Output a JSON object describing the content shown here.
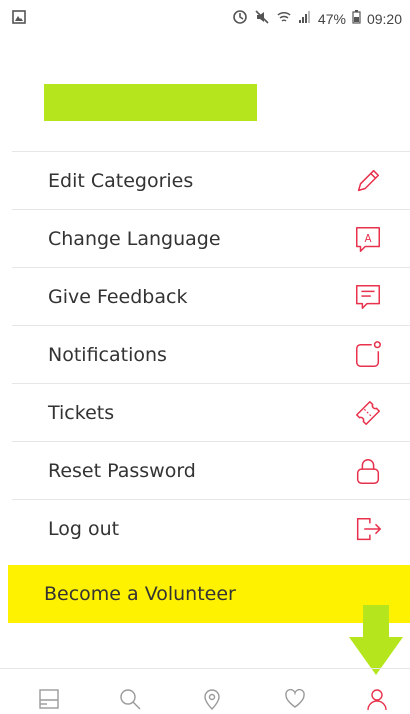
{
  "status_bar": {
    "battery": "47%",
    "time": "09:20"
  },
  "menu": {
    "items": [
      {
        "label": "Edit Categories",
        "icon": "pencil-icon"
      },
      {
        "label": "Change Language",
        "icon": "language-icon"
      },
      {
        "label": "Give Feedback",
        "icon": "feedback-icon"
      },
      {
        "label": "Notifications",
        "icon": "notification-icon"
      },
      {
        "label": "Tickets",
        "icon": "ticket-icon"
      },
      {
        "label": "Reset Password",
        "icon": "lock-icon"
      },
      {
        "label": "Log out",
        "icon": "logout-icon"
      }
    ],
    "volunteer_label": "Become a Volunteer"
  },
  "tabbar": {
    "tabs": [
      "home-tab-icon",
      "search-tab-icon",
      "location-tab-icon",
      "favorites-tab-icon",
      "profile-tab-icon"
    ]
  },
  "colors": {
    "accent": "#e8314c",
    "highlight_green": "#b5e61d",
    "volunteer_yellow": "#fff200",
    "tab_gray": "#9a9a9a"
  }
}
